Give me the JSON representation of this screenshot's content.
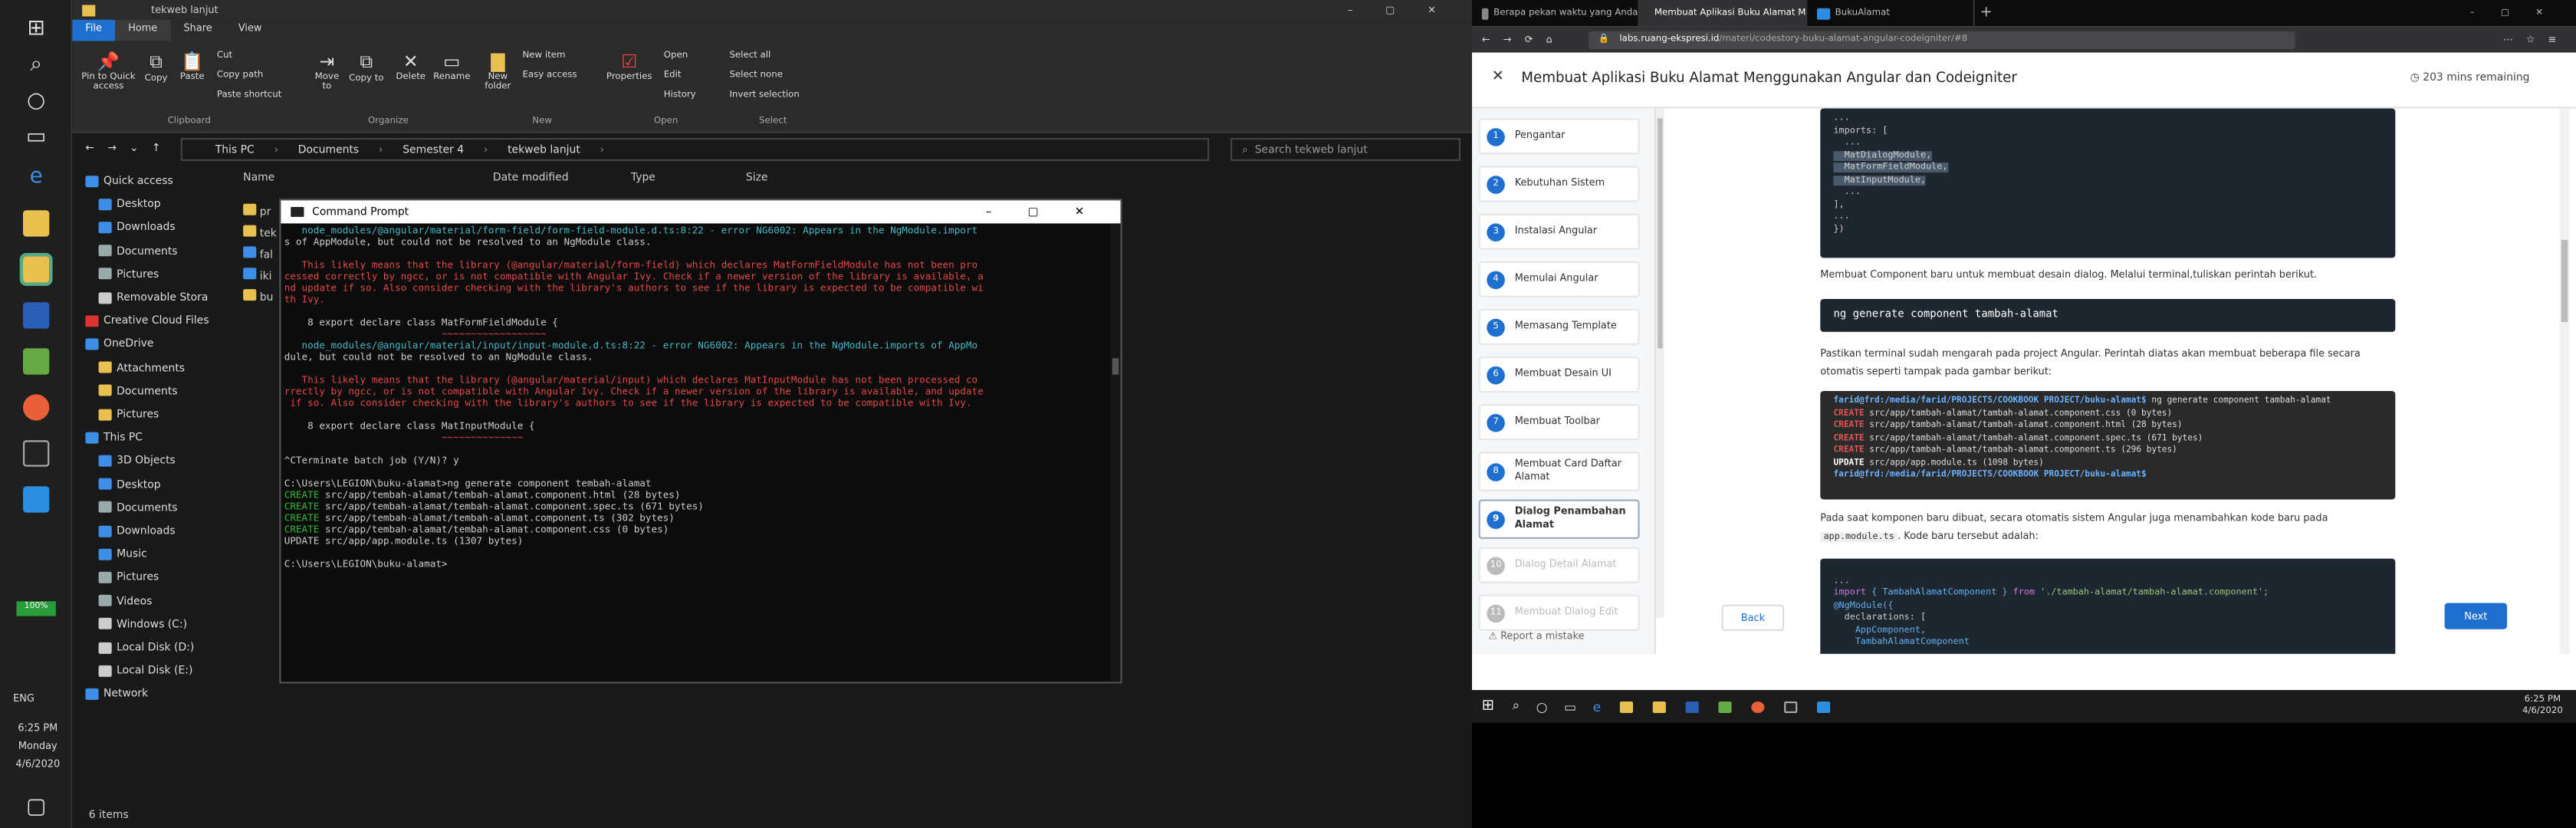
{
  "explorer": {
    "title": "tekweb lanjut",
    "ribbon_tabs": [
      "File",
      "Home",
      "Share",
      "View"
    ],
    "ribbon": {
      "clipboard": {
        "pin": "Pin to Quick access",
        "copy": "Copy",
        "paste": "Paste",
        "cut": "Cut",
        "copy_path": "Copy path",
        "paste_shortcut": "Paste shortcut",
        "group": "Clipboard"
      },
      "organize": {
        "move_to": "Move to",
        "copy_to": "Copy to",
        "delete": "Delete",
        "rename": "Rename",
        "group": "Organize"
      },
      "new": {
        "new_folder": "New folder",
        "new_item": "New item",
        "easy_access": "Easy access",
        "group": "New"
      },
      "open": {
        "properties": "Properties",
        "open": "Open",
        "edit": "Edit",
        "history": "History",
        "group": "Open"
      },
      "select": {
        "select_all": "Select all",
        "select_none": "Select none",
        "invert": "Invert selection",
        "group": "Select"
      }
    },
    "breadcrumb": [
      "This PC",
      "Documents",
      "Semester 4",
      "tekweb lanjut"
    ],
    "search_placeholder": "Search tekweb lanjut",
    "columns": [
      "Name",
      "Date modified",
      "Type",
      "Size"
    ],
    "files": [
      "pr",
      "tek",
      "fal",
      "iki",
      "bu"
    ],
    "nav": [
      {
        "label": "Quick access",
        "indent": 0,
        "color": "#3c8ee6"
      },
      {
        "label": "Desktop",
        "indent": 1,
        "color": "#3c8ee6"
      },
      {
        "label": "Downloads",
        "indent": 1,
        "color": "#3c8ee6"
      },
      {
        "label": "Documents",
        "indent": 1,
        "color": "#9aa"
      },
      {
        "label": "Pictures",
        "indent": 1,
        "color": "#9aa"
      },
      {
        "label": "Removable Stora",
        "indent": 1,
        "color": "#ccc"
      },
      {
        "label": "Creative Cloud Files",
        "indent": 0,
        "color": "#d33"
      },
      {
        "label": "OneDrive",
        "indent": 0,
        "color": "#3c8ee6"
      },
      {
        "label": "Attachments",
        "indent": 1,
        "color": "#e8c050"
      },
      {
        "label": "Documents",
        "indent": 1,
        "color": "#e8c050"
      },
      {
        "label": "Pictures",
        "indent": 1,
        "color": "#e8c050"
      },
      {
        "label": "This PC",
        "indent": 0,
        "color": "#3c8ee6"
      },
      {
        "label": "3D Objects",
        "indent": 1,
        "color": "#3c8ee6"
      },
      {
        "label": "Desktop",
        "indent": 1,
        "color": "#3c8ee6"
      },
      {
        "label": "Documents",
        "indent": 1,
        "color": "#9aa"
      },
      {
        "label": "Downloads",
        "indent": 1,
        "color": "#3c8ee6"
      },
      {
        "label": "Music",
        "indent": 1,
        "color": "#3c8ee6"
      },
      {
        "label": "Pictures",
        "indent": 1,
        "color": "#9aa"
      },
      {
        "label": "Videos",
        "indent": 1,
        "color": "#9aa"
      },
      {
        "label": "Windows (C:)",
        "indent": 1,
        "color": "#ccc"
      },
      {
        "label": "Local Disk (D:)",
        "indent": 1,
        "color": "#ccc"
      },
      {
        "label": "Local Disk (E:)",
        "indent": 1,
        "color": "#ccc"
      },
      {
        "label": "Network",
        "indent": 0,
        "color": "#3c8ee6"
      }
    ],
    "status": "6 items"
  },
  "left_taskbar": {
    "battery": "100%",
    "lang": "ENG",
    "time": "6:25 PM",
    "day": "Monday",
    "date": "4/6/2020"
  },
  "cmd": {
    "title": "Command Prompt",
    "lines": [
      {
        "t": "   node_modules/@angular/material/form-field/form-field-module.d.ts:8:22 - error NG6002: Appears in the NgModule.import",
        "c": "cy"
      },
      {
        "t": "s of AppModule, but could not be resolved to an NgModule class.",
        "c": ""
      },
      {
        "t": "",
        "c": ""
      },
      {
        "t": "   This likely means that the library (@angular/material/form-field) which declares MatFormFieldModule has not been pro",
        "c": "red"
      },
      {
        "t": "cessed correctly by ngcc, or is not compatible with Angular Ivy. Check if a newer version of the library is available, a",
        "c": "red"
      },
      {
        "t": "nd update if so. Also consider checking with the library's authors to see if the library is expected to be compatible wi",
        "c": "red"
      },
      {
        "t": "th Ivy.",
        "c": "red"
      },
      {
        "t": "",
        "c": ""
      },
      {
        "t": "    8 export declare class MatFormFieldModule {",
        "c": ""
      },
      {
        "t": "                           ~~~~~~~~~~~~~~~~~~",
        "c": "red"
      },
      {
        "t": "   node_modules/@angular/material/input/input-module.d.ts:8:22 - error NG6002: Appears in the NgModule.imports of AppMo",
        "c": "cy"
      },
      {
        "t": "dule, but could not be resolved to an NgModule class.",
        "c": ""
      },
      {
        "t": "",
        "c": ""
      },
      {
        "t": "   This likely means that the library (@angular/material/input) which declares MatInputModule has not been processed co",
        "c": "red"
      },
      {
        "t": "rrectly by ngcc, or is not compatible with Angular Ivy. Check if a newer version of the library is available, and update",
        "c": "red"
      },
      {
        "t": " if so. Also consider checking with the library's authors to see if the library is expected to be compatible with Ivy.",
        "c": "red"
      },
      {
        "t": "",
        "c": ""
      },
      {
        "t": "    8 export declare class MatInputModule {",
        "c": ""
      },
      {
        "t": "                           ~~~~~~~~~~~~~~",
        "c": "red"
      },
      {
        "t": "",
        "c": ""
      },
      {
        "t": "^CTerminate batch job (Y/N)? y",
        "c": ""
      },
      {
        "t": "",
        "c": ""
      },
      {
        "t": "C:\\Users\\LEGION\\buku-alamat>ng generate component tembah-alamat",
        "c": ""
      },
      {
        "t": "CREATE src/app/tembah-alamat/tembah-alamat.component.html (28 bytes)",
        "c": "grp"
      },
      {
        "t": "CREATE src/app/tembah-alamat/tembah-alamat.component.spec.ts (671 bytes)",
        "c": "grp"
      },
      {
        "t": "CREATE src/app/tembah-alamat/tembah-alamat.component.ts (302 bytes)",
        "c": "grp"
      },
      {
        "t": "CREATE src/app/tembah-alamat/tembah-alamat.component.css (0 bytes)",
        "c": "grp"
      },
      {
        "t": "UPDATE src/app/app.module.ts (1307 bytes)",
        "c": ""
      },
      {
        "t": "",
        "c": ""
      },
      {
        "t": "C:\\Users\\LEGION\\buku-alamat>",
        "c": ""
      }
    ]
  },
  "browser": {
    "tabs": [
      "Berapa pekan waktu yang Anda",
      "Membuat Aplikasi Buku Alamat M",
      "BukuAlamat"
    ],
    "url_host": "labs.ruang-ekspresi.id",
    "url_path": "/materi/codestory-buku-alamat-angular-codeigniter/#8",
    "page_title": "Membuat Aplikasi Buku Alamat Menggunakan Angular dan Codeigniter",
    "remaining": "203 mins remaining",
    "steps": [
      {
        "n": "1",
        "label": "Pengantar",
        "state": "done"
      },
      {
        "n": "2",
        "label": "Kebutuhan Sistem",
        "state": "done"
      },
      {
        "n": "3",
        "label": "Instalasi Angular",
        "state": "done"
      },
      {
        "n": "4",
        "label": "Memulai Angular",
        "state": "done"
      },
      {
        "n": "5",
        "label": "Memasang Template",
        "state": "done"
      },
      {
        "n": "6",
        "label": "Membuat Desain UI",
        "state": "done"
      },
      {
        "n": "7",
        "label": "Membuat Toolbar",
        "state": "done"
      },
      {
        "n": "8",
        "label": "Membuat Card Daftar Alamat",
        "state": "done"
      },
      {
        "n": "9",
        "label": "Dialog Penambahan Alamat",
        "state": "cur"
      },
      {
        "n": "10",
        "label": "Dialog Detail Alamat",
        "state": "dis"
      },
      {
        "n": "11",
        "label": "Membuat Dialog Edit",
        "state": "dis"
      }
    ],
    "report": "Report a mistake",
    "back": "Back",
    "next": "Next",
    "code1": [
      "...",
      "imports: [",
      "  ...",
      "  MatDialogModule,",
      "  MatFormFieldModule,",
      "  MatInputModule,",
      "  ...",
      "],",
      "...",
      "})"
    ],
    "p1": "Membuat Component baru untuk membuat desain dialog. Melalui terminal,tuliskan perintah berikut.",
    "cmd1": "ng generate component tambah-alamat",
    "p2": "Pastikan terminal sudah mengarah pada project Angular. Perintah diatas akan membuat beberapa file secara otomatis seperti tampak pada gambar berikut:",
    "term": [
      {
        "prompt": "farid@frd:/media/farid/PROJECTS/COOKBOOK PROJECT/buku-alamat$",
        "rest": " ng generate component tambah-alamat"
      },
      {
        "prompt": "CREATE",
        "rest": " src/app/tambah-alamat/tambah-alamat.component.css (0 bytes)"
      },
      {
        "prompt": "CREATE",
        "rest": " src/app/tambah-alamat/tambah-alamat.component.html (28 bytes)"
      },
      {
        "prompt": "CREATE",
        "rest": " src/app/tambah-alamat/tambah-alamat.component.spec.ts (671 bytes)"
      },
      {
        "prompt": "CREATE",
        "rest": " src/app/tambah-alamat/tambah-alamat.component.ts (296 bytes)"
      },
      {
        "prompt": "UPDATE",
        "rest": " src/app/app.module.ts (1098 bytes)"
      },
      {
        "prompt": "farid@frd:/media/farid/PROJECTS/COOKBOOK PROJECT/buku-alamat$",
        "rest": " "
      }
    ],
    "p3a": "Pada saat komponen baru dibuat, secara otomatis sistem Angular juga menambahkan kode baru pada",
    "p3code": "app.module.ts",
    "p3b": ". Kode baru tersebut adalah:",
    "code2": {
      "l1": "...",
      "import_kw": "import",
      "import_cls": " { TambahAlamatComponent } ",
      "from_kw": "from",
      "import_path": " './tambah-alamat/tambah-alamat.component';",
      "ngmodule": "@NgModule({",
      "decl": "  declarations: [",
      "c1": "    AppComponent,",
      "c2": "    TambahAlamatComponent"
    }
  },
  "right_taskbar": {
    "time": "6:25 PM",
    "date": "4/6/2020"
  }
}
